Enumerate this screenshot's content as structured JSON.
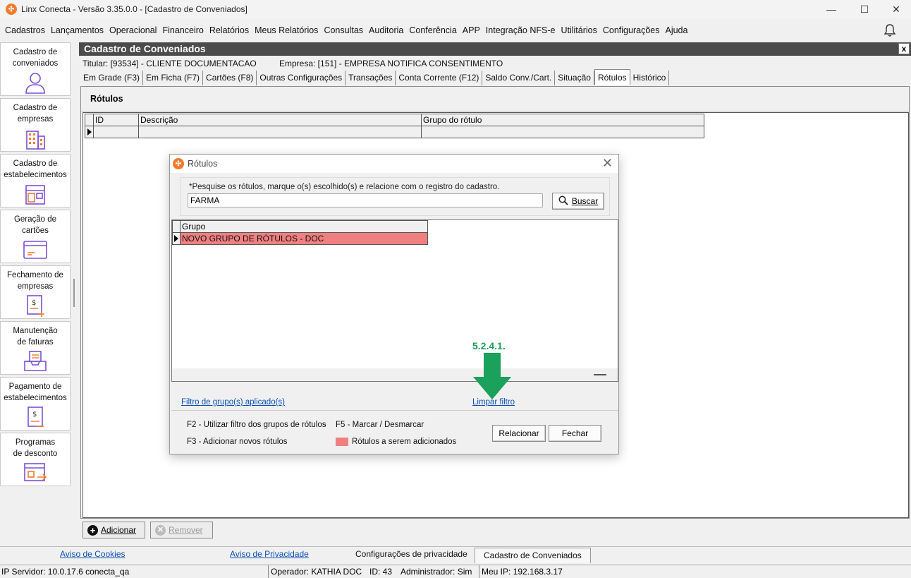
{
  "window": {
    "title": "Linx Conecta - Versão 3.35.0.0 - [Cadastro de Conveniados]",
    "minimize": "—",
    "maximize": "☐",
    "close": "✕"
  },
  "menu": [
    "Cadastros",
    "Lançamentos",
    "Operacional",
    "Financeiro",
    "Relatórios",
    "Meus Relatórios",
    "Consultas",
    "Auditoria",
    "Conferência",
    "APP",
    "Integração NFS-e",
    "Utilitários",
    "Configurações",
    "Ajuda"
  ],
  "sidebar": [
    {
      "label": "Cadastro de\nconveniados",
      "icon": "person-icon"
    },
    {
      "label": "Cadastro de\nempresas",
      "icon": "building-icon"
    },
    {
      "label": "Cadastro de\nestabelecimentos",
      "icon": "store-icon"
    },
    {
      "label": "Geração de\ncartões",
      "icon": "card-icon"
    },
    {
      "label": "Fechamento de\nempresas",
      "icon": "invoice-add-icon"
    },
    {
      "label": "Manutenção\nde faturas",
      "icon": "inbox-tray-icon"
    },
    {
      "label": "Pagamento de\nestabelecimentos",
      "icon": "payment-doc-icon"
    },
    {
      "label": "Programas\nde desconto",
      "icon": "discount-program-icon"
    }
  ],
  "panel": {
    "title": "Cadastro de Conveniados",
    "close": "x",
    "titular": "Titular: [93534] - CLIENTE DOCUMENTACAO",
    "empresa": "Empresa: [151] - EMPRESA NOTIFICA CONSENTIMENTO",
    "tabs": [
      "Em Grade (F3)",
      "Em Ficha (F7)",
      "Cartões (F8)",
      "Outras Configurações",
      "Transações",
      "Conta Corrente (F12)",
      "Saldo Conv./Cart.",
      "Situação",
      "Rótulos",
      "Histórico"
    ],
    "active_tab": "Rótulos",
    "section_title": "Rótulos",
    "grid_headers": [
      "ID",
      "Descrição",
      "Grupo do rótulo"
    ],
    "add_button": "Adicionar",
    "remove_button": "Remover"
  },
  "dialog": {
    "title": "Rótulos",
    "close": "✕",
    "hint": "*Pesquise os rótulos, marque o(s) escolhido(s) e relacione com o registro do cadastro.",
    "search_value": "FARMA",
    "search_button": "Buscar",
    "list_header": "Grupo",
    "list_rows": [
      "NOVO GRUPO DE RÓTULOS - DOC"
    ],
    "annotation": "5.2.4.1.",
    "filter_link": "Filtro de grupo(s) aplicado(s)",
    "clear_filter_link": "Limpar filtro",
    "shortcut_f2": "F2 - Utilizar filtro dos grupos de rótulos",
    "sep": "-",
    "shortcut_f5": "F5 - Marcar / Desmarcar",
    "shortcut_f3": "F3 - Adicionar novos rótulos",
    "legend": "Rótulos a serem adicionados",
    "relate_button": "Relacionar",
    "close_button": "Fechar",
    "colors": {
      "highlight": "#f08080",
      "annotation": "#1aa15b"
    }
  },
  "bottom_tabs": {
    "cookies": "Aviso de Cookies",
    "privacy": "Aviso de Privacidade",
    "privacy_settings": "Configurações de privacidade",
    "active": "Cadastro de Conveniados"
  },
  "status": {
    "server": "IP Servidor: 10.0.17.6 conecta_qa",
    "operator": "Operador: KATHIA DOC",
    "id": "ID: 43",
    "admin": "Administrador: Sim",
    "ip": "Meu IP: 192.168.3.17"
  }
}
